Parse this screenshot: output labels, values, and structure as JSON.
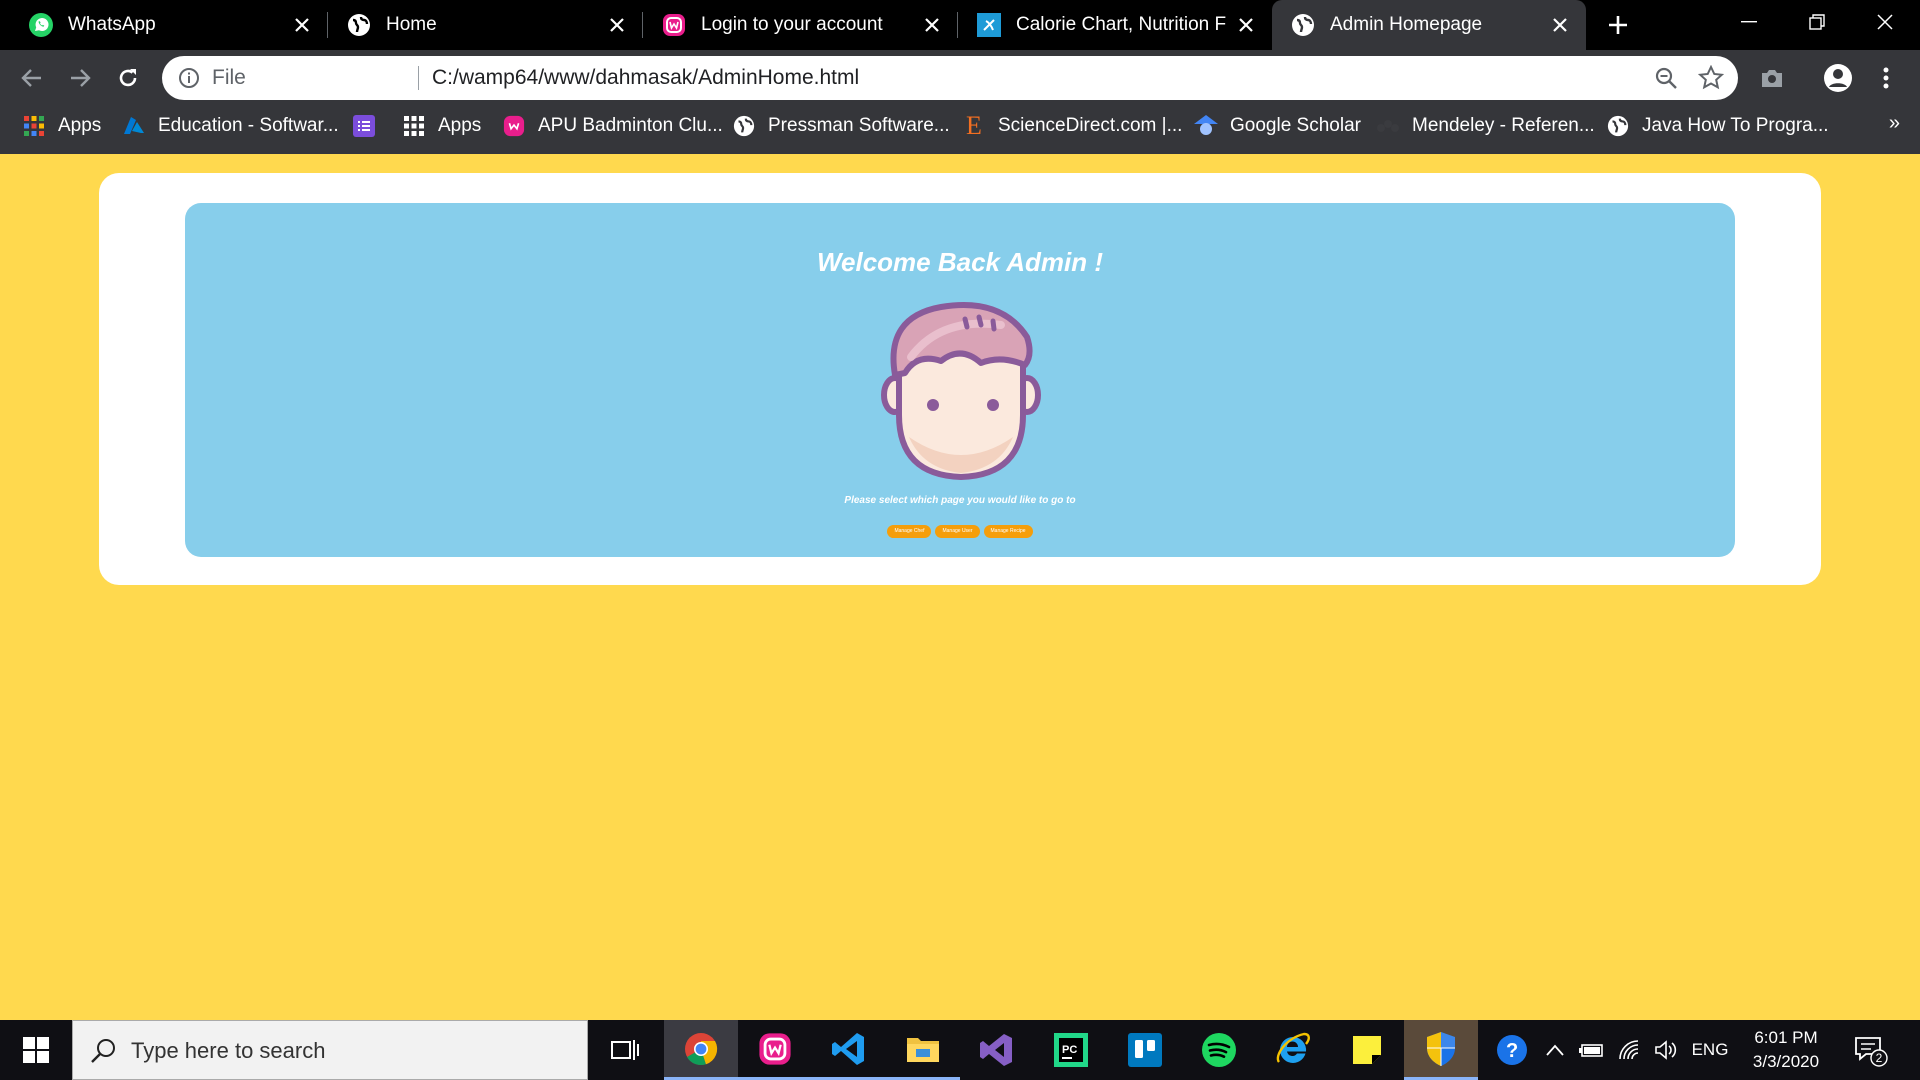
{
  "browser": {
    "tabs": [
      {
        "title": "WhatsApp",
        "icon": "whatsapp-icon"
      },
      {
        "title": "Home",
        "icon": "globe-icon"
      },
      {
        "title": "Login to your account",
        "icon": "wampserver-icon"
      },
      {
        "title": "Calorie Chart, Nutrition Fact",
        "icon": "calorieking-icon"
      },
      {
        "title": "Admin Homepage",
        "icon": "globe-icon",
        "active": true
      }
    ],
    "address": {
      "scheme_label": "File",
      "url": "C:/wamp64/www/dahmasak/AdminHome.html"
    },
    "bookmarks": [
      {
        "label": "Apps"
      },
      {
        "label": "Education - Softwar..."
      },
      {
        "label": ""
      },
      {
        "label": "Apps"
      },
      {
        "label": "APU Badminton Clu..."
      },
      {
        "label": "Pressman Software..."
      },
      {
        "label": "ScienceDirect.com |..."
      },
      {
        "label": "Google Scholar"
      },
      {
        "label": "Mendeley - Referen..."
      },
      {
        "label": "Java How To Progra..."
      }
    ],
    "bookmarks_more": "»"
  },
  "page": {
    "heading": "Welcome Back Admin !",
    "prompt": "Please select which page you would like to go to",
    "buttons": [
      "Manage Chef",
      "Manage User",
      "Manage Recipe"
    ],
    "colors": {
      "background": "#ffd94e",
      "hero": "#87ceeb",
      "button": "#f59e0b"
    }
  },
  "taskbar": {
    "search_placeholder": "Type here to search",
    "tray_language": "ENG",
    "time": "6:01 PM",
    "date": "3/3/2020",
    "notification_count": "2"
  }
}
